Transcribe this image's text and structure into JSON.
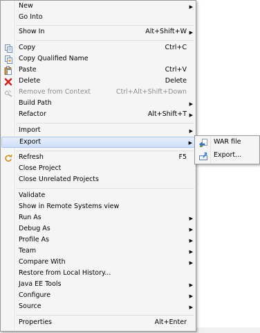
{
  "menu": {
    "items": [
      {
        "label": "New",
        "submenu": true
      },
      {
        "label": "Go Into"
      },
      {
        "label": "Show In",
        "accel": "Alt+Shift+W",
        "submenu": true
      },
      {
        "label": "Copy",
        "accel": "Ctrl+C",
        "icon": "copy-icon"
      },
      {
        "label": "Copy Qualified Name",
        "icon": "copy-qualified-icon"
      },
      {
        "label": "Paste",
        "accel": "Ctrl+V",
        "icon": "paste-icon"
      },
      {
        "label": "Delete",
        "accel": "Delete",
        "icon": "delete-icon"
      },
      {
        "label": "Remove from Context",
        "accel": "Ctrl+Alt+Shift+Down",
        "icon": "remove-context-icon",
        "disabled": true
      },
      {
        "label": "Build Path",
        "submenu": true
      },
      {
        "label": "Refactor",
        "accel": "Alt+Shift+T",
        "submenu": true
      },
      {
        "label": "Import",
        "submenu": true
      },
      {
        "label": "Export",
        "submenu": true,
        "highlighted": true
      },
      {
        "label": "Refresh",
        "accel": "F5",
        "icon": "refresh-icon"
      },
      {
        "label": "Close Project"
      },
      {
        "label": "Close Unrelated Projects"
      },
      {
        "label": "Validate"
      },
      {
        "label": "Show in Remote Systems view"
      },
      {
        "label": "Run As",
        "submenu": true
      },
      {
        "label": "Debug As",
        "submenu": true
      },
      {
        "label": "Profile As",
        "submenu": true
      },
      {
        "label": "Team",
        "submenu": true
      },
      {
        "label": "Compare With",
        "submenu": true
      },
      {
        "label": "Restore from Local History..."
      },
      {
        "label": "Java EE Tools",
        "submenu": true
      },
      {
        "label": "Configure",
        "submenu": true
      },
      {
        "label": "Source",
        "submenu": true
      },
      {
        "label": "Properties",
        "accel": "Alt+Enter"
      }
    ],
    "submenu_arrow": "▶"
  },
  "export_submenu": {
    "items": [
      {
        "label": "WAR file",
        "icon": "war-file-icon"
      },
      {
        "label": "Export...",
        "icon": "export-wizard-icon"
      }
    ]
  }
}
